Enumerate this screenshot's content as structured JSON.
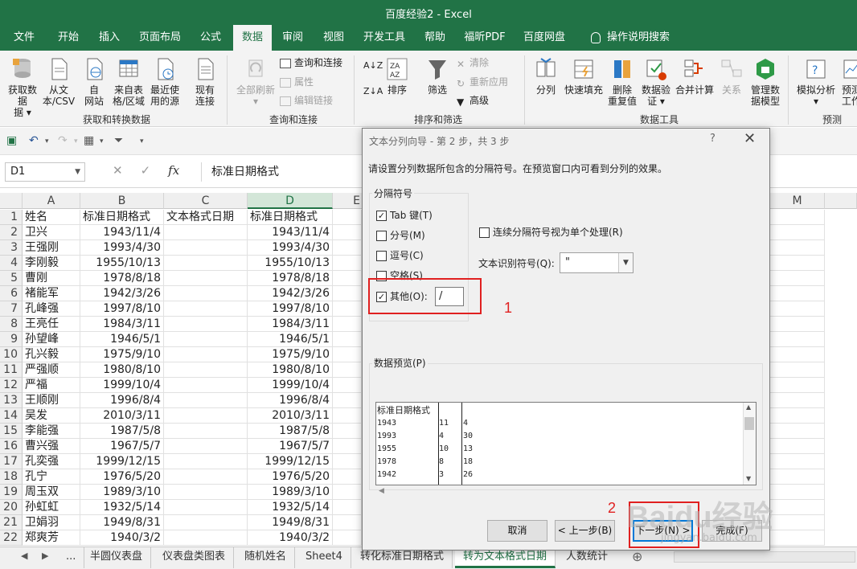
{
  "window": {
    "title": "百度经验2 - Excel"
  },
  "ribbon_tabs": [
    "文件",
    "开始",
    "插入",
    "页面布局",
    "公式",
    "数据",
    "审阅",
    "视图",
    "开发工具",
    "帮助",
    "福昕PDF",
    "百度网盘",
    "操作说明搜索"
  ],
  "ribbon": {
    "get_transform": {
      "label": "获取和转换数据",
      "get_data": "获取数据",
      "get_data2": "据 ▾",
      "from_csv": "从文",
      "from_csv2": "本/CSV",
      "from_web": "自",
      "from_web2": "网站",
      "from_table": "来自表",
      "from_table2": "格/区域",
      "recent": "最近使",
      "recent2": "用的源",
      "existing": "现有",
      "existing2": "连接"
    },
    "queries": {
      "label": "查询和连接",
      "refresh_all": "全部刷新",
      "queries_conn": "查询和连接",
      "properties": "属性",
      "edit_links": "编辑链接"
    },
    "sort_filter": {
      "label": "排序和筛选",
      "sort": "排序",
      "filter": "筛选",
      "clear": "清除",
      "reapply": "重新应用",
      "advanced": "高级"
    },
    "data_tools": {
      "label": "数据工具",
      "split": "分列",
      "flash_fill": "快速填充",
      "remove_dup": "删除",
      "remove_dup2": "重复值",
      "validation": "数据验",
      "validation2": "证 ▾",
      "consolidate": "合并计算",
      "relations": "关系",
      "data_model": "管理数",
      "data_model2": "据模型"
    },
    "forecast": {
      "label": "预测",
      "whatif": "模拟分析",
      "whatif2": "▾",
      "sheet": "预测",
      "sheet2": "工作"
    }
  },
  "formula_bar": {
    "name_box": "D1",
    "fx": "fx",
    "content": "标准日期格式"
  },
  "columns": [
    "A",
    "B",
    "C",
    "D",
    "E",
    "M"
  ],
  "selected_column": "D",
  "rows": [
    [
      "姓名",
      "标准日期格式",
      "文本格式日期",
      "标准日期格式"
    ],
    [
      "卫兴",
      "1943/11/4",
      "",
      "1943/11/4"
    ],
    [
      "王强刚",
      "1993/4/30",
      "",
      "1993/4/30"
    ],
    [
      "李刚毅",
      "1955/10/13",
      "",
      "1955/10/13"
    ],
    [
      "曹刚",
      "1978/8/18",
      "",
      "1978/8/18"
    ],
    [
      "褚能军",
      "1942/3/26",
      "",
      "1942/3/26"
    ],
    [
      "孔峰强",
      "1997/8/10",
      "",
      "1997/8/10"
    ],
    [
      "王亮任",
      "1984/3/11",
      "",
      "1984/3/11"
    ],
    [
      "孙望峰",
      "1946/5/1",
      "",
      "1946/5/1"
    ],
    [
      "孔兴毅",
      "1975/9/10",
      "",
      "1975/9/10"
    ],
    [
      "严强顺",
      "1980/8/10",
      "",
      "1980/8/10"
    ],
    [
      "严福",
      "1999/10/4",
      "",
      "1999/10/4"
    ],
    [
      "王顺刚",
      "1996/8/4",
      "",
      "1996/8/4"
    ],
    [
      "吴发",
      "2010/3/11",
      "",
      "2010/3/11"
    ],
    [
      "李能强",
      "1987/5/8",
      "",
      "1987/5/8"
    ],
    [
      "曹兴强",
      "1967/5/7",
      "",
      "1967/5/7"
    ],
    [
      "孔奕强",
      "1999/12/15",
      "",
      "1999/12/15"
    ],
    [
      "孔宁",
      "1976/5/20",
      "",
      "1976/5/20"
    ],
    [
      "周玉双",
      "1989/3/10",
      "",
      "1989/3/10"
    ],
    [
      "孙虹虹",
      "1932/5/14",
      "",
      "1932/5/14"
    ],
    [
      "卫娟羽",
      "1949/8/31",
      "",
      "1949/8/31"
    ],
    [
      "郑爽芳",
      "1940/3/2",
      "",
      "1940/3/2"
    ]
  ],
  "sheet_tabs": [
    "...",
    "半圆仪表盘",
    "仪表盘类图表",
    "随机姓名",
    "Sheet4",
    "转化标准日期格式",
    "转为文本格式日期",
    "人数统计"
  ],
  "active_sheet": "转为文本格式日期",
  "dialog": {
    "title": "文本分列向导 - 第 2 步，共 3 步",
    "help": "?",
    "close": "✕",
    "instruction": "请设置分列数据所包含的分隔符号。在预览窗口内可看到分列的效果。",
    "delimiters_label": "分隔符号",
    "tab": {
      "label": "Tab 键(T)",
      "checked": true
    },
    "semicolon": {
      "label": "分号(M)",
      "checked": false
    },
    "comma": {
      "label": "逗号(C)",
      "checked": false
    },
    "space": {
      "label": "空格(S)",
      "checked": false
    },
    "other": {
      "label": "其他(O):",
      "checked": true,
      "value": "/"
    },
    "consecutive": {
      "label": "连续分隔符号视为单个处理(R)",
      "checked": false
    },
    "qualifier_label": "文本识别符号(Q):",
    "qualifier_value": "\"",
    "preview_label": "数据预览(P)",
    "preview": [
      [
        "标准日期格式",
        "",
        ""
      ],
      [
        "1943",
        "11",
        "4"
      ],
      [
        "1993",
        "4",
        "30"
      ],
      [
        "1955",
        "10",
        "13"
      ],
      [
        "1978",
        "8",
        "18"
      ],
      [
        "1942",
        "3",
        "26"
      ]
    ],
    "buttons": {
      "cancel": "取消",
      "back": "< 上一步(B)",
      "next": "下一步(N) >",
      "finish": "完成(F)"
    },
    "annotations": {
      "one": "1",
      "two": "2"
    }
  },
  "watermark": {
    "main": "Baidu经验",
    "sub": "jingyan.baidu.com"
  }
}
